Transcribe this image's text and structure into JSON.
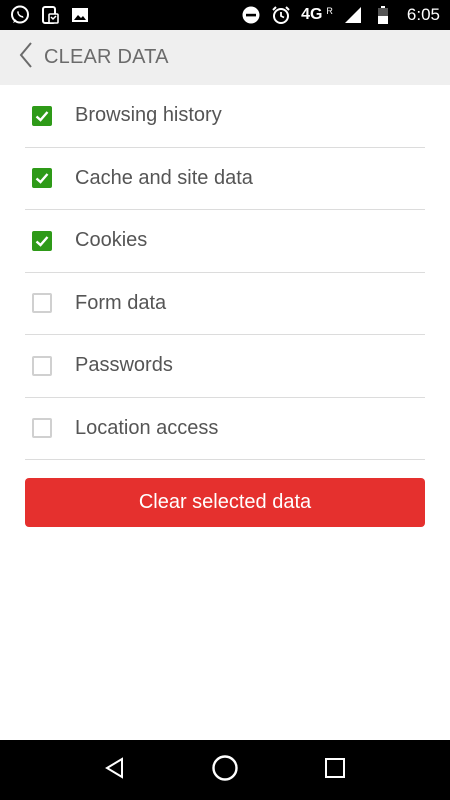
{
  "status_bar": {
    "network": "4G",
    "roaming": "R",
    "time": "6:05",
    "icons_left": [
      "whatsapp-icon",
      "phone-app-icon",
      "gallery-icon"
    ],
    "icons_right": [
      "do-not-disturb-icon",
      "alarm-icon",
      "signal-icon",
      "battery-icon"
    ]
  },
  "header": {
    "title": "CLEAR DATA",
    "back_icon": "chevron-left-icon"
  },
  "options": [
    {
      "label": "Browsing history",
      "checked": true
    },
    {
      "label": "Cache and site data",
      "checked": true
    },
    {
      "label": "Cookies",
      "checked": true
    },
    {
      "label": "Form data",
      "checked": false
    },
    {
      "label": "Passwords",
      "checked": false
    },
    {
      "label": "Location access",
      "checked": false
    }
  ],
  "clear_button": {
    "label": "Clear selected data"
  },
  "colors": {
    "accent": "#e5302e",
    "checkbox_checked": "#2e9a18",
    "header_bg": "#efefef"
  },
  "nav_bar": {
    "icons": [
      "back-icon",
      "home-icon",
      "recents-icon"
    ]
  }
}
